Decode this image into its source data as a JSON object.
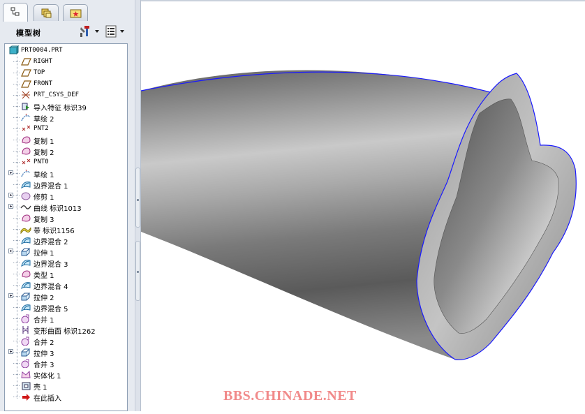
{
  "model_tree": {
    "title": "模型树",
    "tabs": [
      {
        "icon": "model-tree-icon",
        "active": true
      },
      {
        "icon": "layers-icon",
        "active": false
      },
      {
        "icon": "favorites-icon",
        "active": false
      }
    ],
    "items": [
      {
        "label": "PRT0004.PRT",
        "icon": "part-icon",
        "expander": false,
        "indent": 0,
        "mono": true
      },
      {
        "label": "RIGHT",
        "icon": "datum-plane-icon",
        "expander": false,
        "indent": 1,
        "mono": true
      },
      {
        "label": "TOP",
        "icon": "datum-plane-icon",
        "expander": false,
        "indent": 1,
        "mono": true
      },
      {
        "label": "FRONT",
        "icon": "datum-plane-icon",
        "expander": false,
        "indent": 1,
        "mono": true
      },
      {
        "label": "PRT_CSYS_DEF",
        "icon": "csys-icon",
        "expander": false,
        "indent": 1,
        "mono": true
      },
      {
        "label": "导入特征 标识39",
        "icon": "import-feature-icon",
        "expander": false,
        "indent": 1,
        "mono": false
      },
      {
        "label": "草绘 2",
        "icon": "sketch-icon",
        "expander": false,
        "indent": 1,
        "mono": false
      },
      {
        "label": "PNT2",
        "icon": "datum-point-icon",
        "expander": false,
        "indent": 1,
        "mono": true
      },
      {
        "label": "复制 1",
        "icon": "copy-surface-icon",
        "expander": false,
        "indent": 1,
        "mono": false
      },
      {
        "label": "复制 2",
        "icon": "copy-surface-icon",
        "expander": false,
        "indent": 1,
        "mono": false
      },
      {
        "label": "PNT0",
        "icon": "datum-point-icon",
        "expander": false,
        "indent": 1,
        "mono": true
      },
      {
        "label": "草绘 1",
        "icon": "sketch-icon",
        "expander": true,
        "indent": 1,
        "mono": false
      },
      {
        "label": "边界混合 1",
        "icon": "boundary-blend-icon",
        "expander": false,
        "indent": 1,
        "mono": false
      },
      {
        "label": "修剪 1",
        "icon": "trim-icon",
        "expander": true,
        "indent": 1,
        "mono": false
      },
      {
        "label": "曲线 标识1013",
        "icon": "curve-icon",
        "expander": true,
        "indent": 1,
        "mono": false
      },
      {
        "label": "复制 3",
        "icon": "copy-surface-icon",
        "expander": false,
        "indent": 1,
        "mono": false
      },
      {
        "label": "带 标识1156",
        "icon": "ribbon-icon",
        "expander": false,
        "indent": 1,
        "mono": false
      },
      {
        "label": "边界混合 2",
        "icon": "boundary-blend-icon",
        "expander": false,
        "indent": 1,
        "mono": false
      },
      {
        "label": "拉伸 1",
        "icon": "extrude-icon",
        "expander": true,
        "indent": 1,
        "mono": false
      },
      {
        "label": "边界混合 3",
        "icon": "boundary-blend-icon",
        "expander": false,
        "indent": 1,
        "mono": false
      },
      {
        "label": "类型 1",
        "icon": "copy-surface-icon",
        "expander": false,
        "indent": 1,
        "mono": false
      },
      {
        "label": "边界混合 4",
        "icon": "boundary-blend-icon",
        "expander": false,
        "indent": 1,
        "mono": false
      },
      {
        "label": "拉伸 2",
        "icon": "extrude-icon",
        "expander": true,
        "indent": 1,
        "mono": false
      },
      {
        "label": "边界混合 5",
        "icon": "boundary-blend-icon",
        "expander": false,
        "indent": 1,
        "mono": false
      },
      {
        "label": "合并 1",
        "icon": "merge-icon",
        "expander": false,
        "indent": 1,
        "mono": false
      },
      {
        "label": "变形曲面 标识1262",
        "icon": "warp-surface-icon",
        "expander": false,
        "indent": 1,
        "mono": false
      },
      {
        "label": "合并 2",
        "icon": "merge-icon",
        "expander": false,
        "indent": 1,
        "mono": false
      },
      {
        "label": "拉伸 3",
        "icon": "extrude-icon",
        "expander": true,
        "indent": 1,
        "mono": false
      },
      {
        "label": "合并 3",
        "icon": "merge-icon",
        "expander": false,
        "indent": 1,
        "mono": false
      },
      {
        "label": "实体化 1",
        "icon": "solidify-icon",
        "expander": false,
        "indent": 1,
        "mono": false
      },
      {
        "label": "壳 1",
        "icon": "shell-icon",
        "expander": false,
        "indent": 1,
        "mono": false
      },
      {
        "label": "在此插入",
        "icon": "insert-here-arrow-icon",
        "expander": false,
        "indent": 1,
        "mono": false
      }
    ]
  },
  "viewport": {
    "model": "shelled-swept-tube",
    "shade_color": "#8c8c8c",
    "edge_color": "#1a1aff"
  },
  "watermark": "BBS.CHINADE.NET"
}
